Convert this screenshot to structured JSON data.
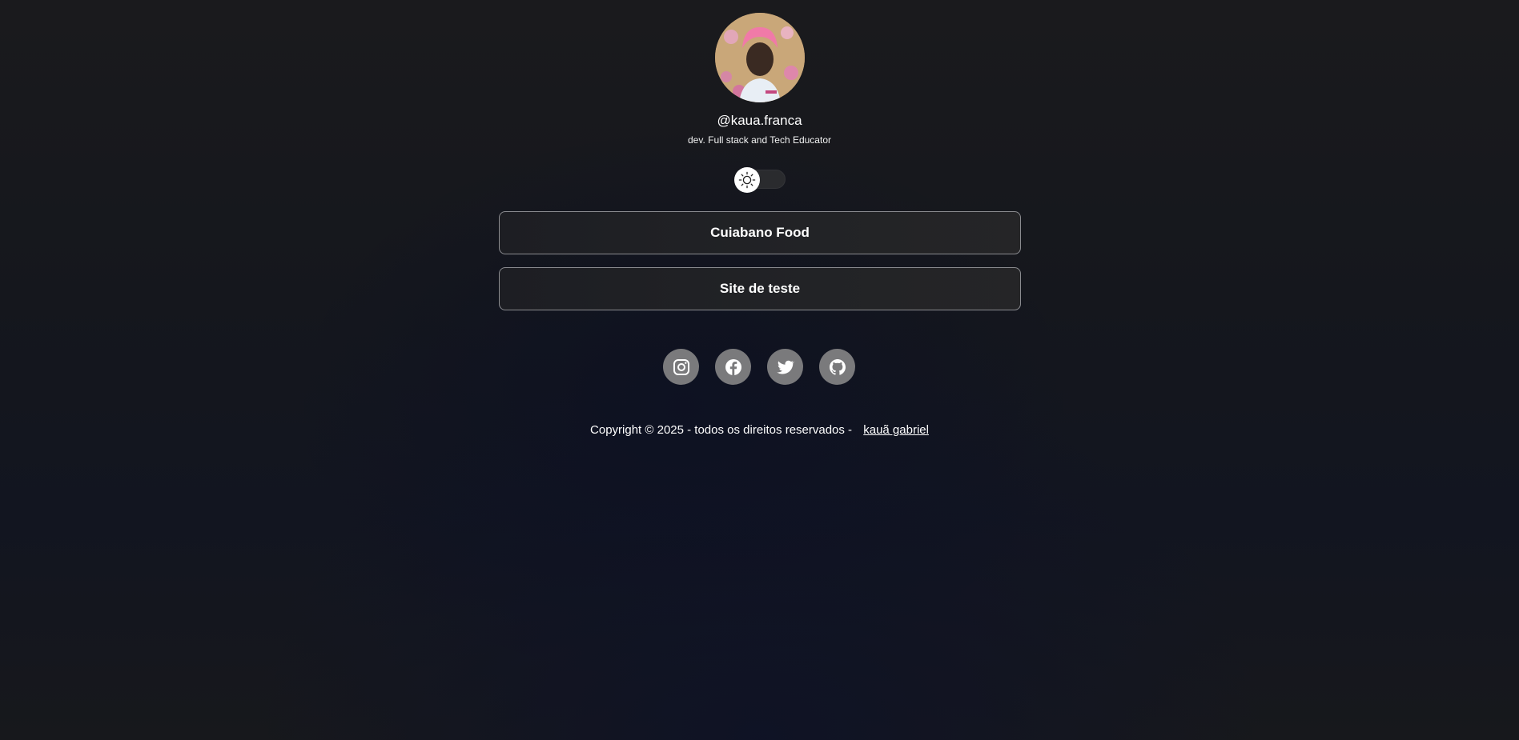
{
  "profile": {
    "handle": "@kaua.franca",
    "bio": "dev. Full stack and Tech Educator"
  },
  "theme_toggle": {
    "icon": "sun-icon",
    "state": "light-off"
  },
  "links": [
    {
      "label": "Cuiabano Food"
    },
    {
      "label": "Site de teste"
    }
  ],
  "socials": [
    {
      "icon": "instagram-icon"
    },
    {
      "icon": "facebook-icon"
    },
    {
      "icon": "twitter-icon"
    },
    {
      "icon": "github-icon"
    }
  ],
  "footer": {
    "text": "Copyright © 2025 - todos os direitos reservados -",
    "author_link": "kauã gabriel"
  },
  "colors": {
    "background": "#15171d",
    "button_border": "#8a8b8f",
    "social_bg": "#7a7a7c",
    "text": "#ffffff"
  }
}
